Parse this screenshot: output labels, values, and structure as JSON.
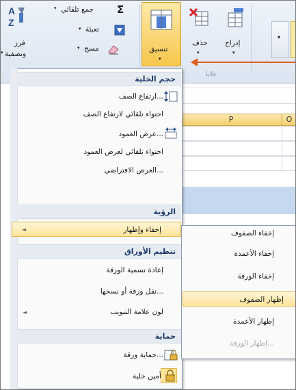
{
  "ribbon": {
    "autosum": "جمع تلقائي",
    "fill": "تعبئة",
    "clear": "مسح",
    "sort_filter_line1": "فرز",
    "sort_filter_line2": "وتصفية",
    "format": "تنسيق",
    "delete": "حذف",
    "insert": "إدراج",
    "cells_group": "خلايا",
    "sigma": "Σ",
    "az": "AZ"
  },
  "sheet": {
    "col_p": "P",
    "col_o": "O"
  },
  "menu": {
    "cell_size_header": "حجم الخلية",
    "row_height": "ارتفاع الصف...",
    "autofit_row": "احتواء تلقائي لارتفاع الصف",
    "col_width": "عرض العمود...",
    "autofit_col": "احتواء تلقائي لعرض العمود",
    "default_width": "العرض الافتراضي...",
    "visibility_header": "الرؤية",
    "hide_unhide": "إخفاء وإظهار",
    "organize_sheets_header": "تنظيم الأوراق",
    "rename_sheet": "إعادة تسمية الورقة",
    "move_copy": "نقل ورقة أو نسخها...",
    "tab_color": "لون علامة التبويب",
    "protection_header": "حماية",
    "protect_sheet": "حماية ورقة...",
    "lock_cell": "تأمين خلية"
  },
  "submenu": {
    "hide_rows": "إخفاء الصفوف",
    "hide_columns": "إخفاء الأعمدة",
    "hide_sheet": "إخفاء الورقة",
    "unhide_rows": "إظهار الصفوف",
    "unhide_columns": "إظهار الأعمدة",
    "unhide_sheet": "إظهار الورقة..."
  },
  "colors": {
    "highlight": "#fde49a",
    "header_text": "#1e3a6b",
    "annotation_arrow": "#e05a1d"
  }
}
